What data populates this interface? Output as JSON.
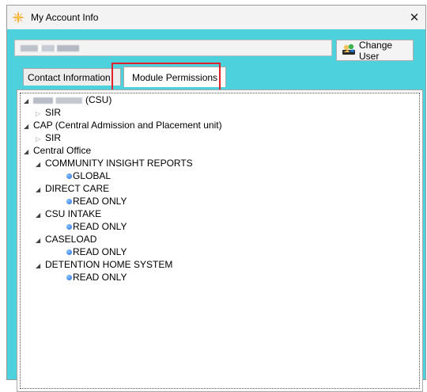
{
  "window": {
    "title": "My Account Info",
    "close_glyph": "✕"
  },
  "user": {
    "name_redacted": "",
    "change_user_label": "Change User"
  },
  "tabs": [
    {
      "label": "Contact Information",
      "active": false
    },
    {
      "label": "Module Permissions",
      "active": true
    }
  ],
  "tree": [
    {
      "label": "(CSU)",
      "redacted_prefix": true,
      "expanded": true,
      "children": [
        {
          "label": "SIR",
          "expanded": false
        }
      ]
    },
    {
      "label": "CAP (Central Admission and Placement unit)",
      "expanded": true,
      "children": [
        {
          "label": "SIR",
          "expanded": false
        }
      ]
    },
    {
      "label": "Central Office",
      "expanded": true,
      "children": [
        {
          "label": "COMMUNITY INSIGHT REPORTS",
          "expanded": true,
          "children": [
            {
              "label": "GLOBAL"
            }
          ]
        },
        {
          "label": "DIRECT CARE",
          "expanded": true,
          "children": [
            {
              "label": "READ ONLY"
            }
          ]
        },
        {
          "label": "CSU INTAKE",
          "expanded": true,
          "children": [
            {
              "label": "READ ONLY"
            }
          ]
        },
        {
          "label": "CASELOAD",
          "expanded": true,
          "children": [
            {
              "label": "READ ONLY"
            }
          ]
        },
        {
          "label": "DETENTION HOME SYSTEM",
          "expanded": true,
          "children": [
            {
              "label": "READ ONLY"
            }
          ]
        }
      ]
    }
  ],
  "icons": {
    "expanded": "◢",
    "collapsed": "▷"
  }
}
